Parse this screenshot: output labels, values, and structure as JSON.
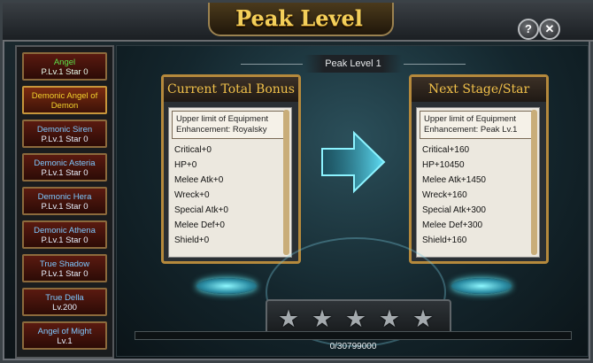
{
  "window": {
    "title": "Peak Level",
    "help_icon": "?",
    "close_icon": "✕"
  },
  "sidebar": {
    "items": [
      {
        "title": "Angel",
        "sub": "P.Lv.1 Star 0",
        "state": "green"
      },
      {
        "title": "Demonic Angel of Demon",
        "sub": "",
        "state": "current"
      },
      {
        "title": "Demonic Siren",
        "sub": "P.Lv.1 Star 0",
        "state": "normal"
      },
      {
        "title": "Demonic Asteria",
        "sub": "P.Lv.1 Star 0",
        "state": "normal"
      },
      {
        "title": "Demonic Hera",
        "sub": "P.Lv.1 Star 0",
        "state": "normal"
      },
      {
        "title": "Demonic Athena",
        "sub": "P.Lv.1 Star 0",
        "state": "normal"
      },
      {
        "title": "True Shadow",
        "sub": "P.Lv.1 Star 0",
        "state": "normal"
      },
      {
        "title": "True Della",
        "sub": "Lv.200",
        "state": "normal"
      },
      {
        "title": "Angel of Might",
        "sub": "Lv.1",
        "state": "normal"
      }
    ]
  },
  "main": {
    "stage_label": "Peak Level 1",
    "current": {
      "title": "Current Total Bonus",
      "limit_text": "Upper limit of Equipment Enhancement: Royalsky",
      "stats": [
        "Critical+0",
        "HP+0",
        "Melee Atk+0",
        "Wreck+0",
        "Special Atk+0",
        "Melee Def+0",
        "Shield+0"
      ]
    },
    "next": {
      "title": "Next Stage/Star",
      "limit_text": "Upper limit of Equipment Enhancement: Peak Lv.1",
      "stats": [
        "Critical+160",
        "HP+10450",
        "Melee Atk+1450",
        "Wreck+160",
        "Special Atk+300",
        "Melee Def+300",
        "Shield+160"
      ]
    },
    "stars": {
      "filled": 0,
      "total": 5
    },
    "progress": {
      "text": "0/30799000",
      "fraction": 0.0
    }
  },
  "colors": {
    "gold": "#f0c04a",
    "accent_cyan": "#56d8f0"
  }
}
